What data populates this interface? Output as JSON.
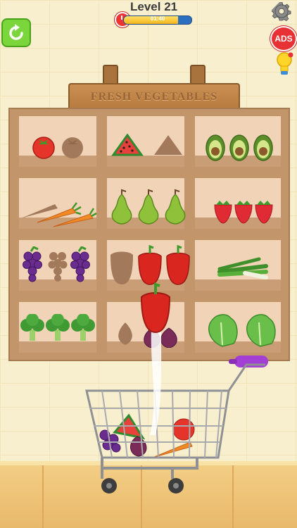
{
  "hud": {
    "level_label": "Level 21",
    "timer_text": "01:40",
    "timer_progress": 0.8,
    "ads_label": "ADS"
  },
  "sign": {
    "title": "FRESH VEGETABLES"
  },
  "icons": {
    "restart": "restart-icon",
    "settings": "gear-icon",
    "hint": "lightbulb-icon"
  },
  "shelf": {
    "rows": [
      [
        "tomato",
        "watermelon",
        "avocado"
      ],
      [
        "carrot",
        "pear",
        "strawberry"
      ],
      [
        "grapes",
        "bell-pepper",
        "green-onion"
      ],
      [
        "broccoli",
        "onion",
        "lettuce"
      ]
    ]
  },
  "held_item": "bell-pepper",
  "cart": {
    "items": [
      "grapes",
      "watermelon",
      "onion",
      "tomato",
      "carrot"
    ]
  },
  "colors": {
    "restart_button": "#7bd63b",
    "ads_button": "#e73134",
    "cart_handle": "#a43fd6",
    "shelf": "#c2956b"
  }
}
